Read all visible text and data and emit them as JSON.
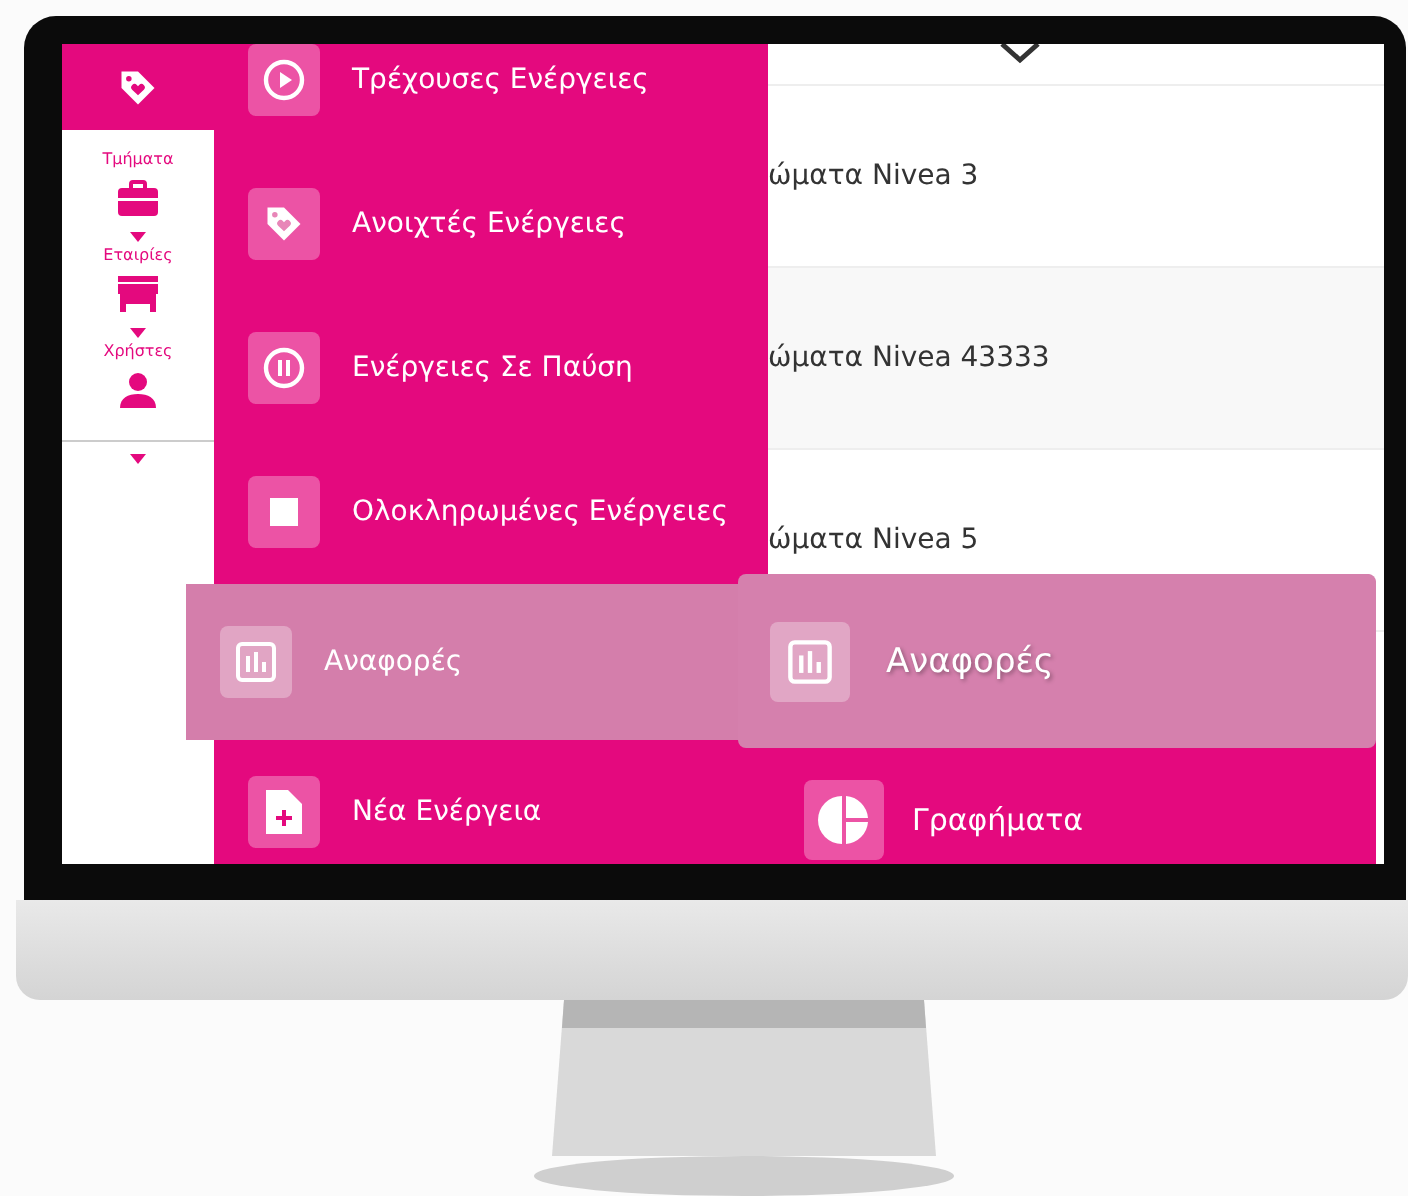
{
  "sidebar": {
    "items": [
      {
        "label": "Τμήματα",
        "kind": "briefcase"
      },
      {
        "label": "Εταιρίες",
        "kind": "store"
      },
      {
        "label": "Χρήστες",
        "kind": "user"
      }
    ]
  },
  "menu": {
    "items": [
      {
        "label": "Τρέχουσες Ενέργειες",
        "kind": "play",
        "highlighted": false
      },
      {
        "label": "Ανοιχτές Ενέργειες",
        "kind": "tag",
        "highlighted": false
      },
      {
        "label": "Ενέργειες Σε Παύση",
        "kind": "pause",
        "highlighted": false
      },
      {
        "label": "Ολοκληρωμένες Ενέργειες",
        "kind": "stop",
        "highlighted": false
      },
      {
        "label": "Αναφορές",
        "kind": "chart",
        "highlighted": true
      },
      {
        "label": "Νέα Ενέργεια",
        "kind": "file",
        "highlighted": false
      }
    ]
  },
  "table": {
    "rows": [
      "ώματα Nivea 3",
      "ώματα Nivea 43333",
      "ώματα Nivea 5"
    ]
  },
  "submenu": {
    "drag_preview": {
      "label": "Αναφορές",
      "kind": "chart"
    },
    "items": [
      {
        "label": "Γραφήματα",
        "kind": "pie"
      }
    ]
  }
}
